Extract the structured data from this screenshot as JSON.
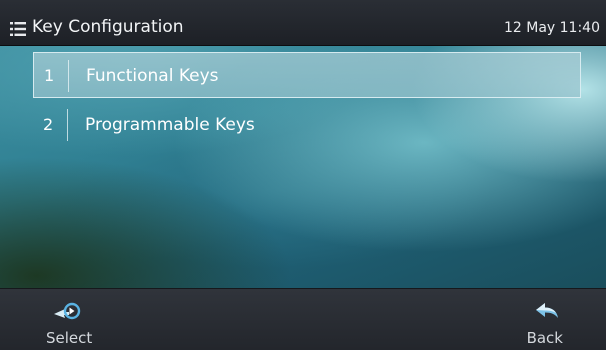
{
  "header": {
    "menu_icon": "list-menu-icon",
    "title": "Key Configuration",
    "datetime": "12 May 11:40"
  },
  "menu": {
    "items": [
      {
        "number": "1",
        "label": "Functional Keys",
        "selected": true
      },
      {
        "number": "2",
        "label": "Programmable Keys",
        "selected": false
      }
    ]
  },
  "softkeys": {
    "select": {
      "label": "Select",
      "icon": "select-arrow-icon"
    },
    "back": {
      "label": "Back",
      "icon": "back-arrow-icon"
    }
  },
  "colors": {
    "header_bg": "#23262c",
    "highlight": "#9fc6cf",
    "wallpaper_accent": "#2f7f92",
    "softkey_icon": "#9fd3ec"
  }
}
